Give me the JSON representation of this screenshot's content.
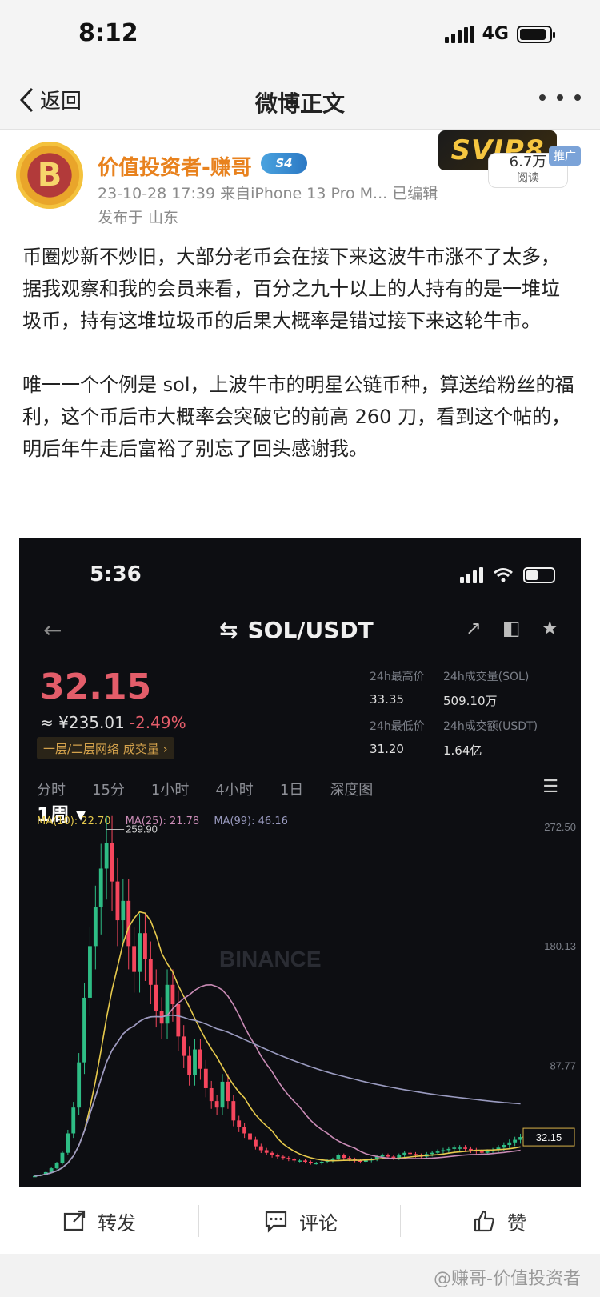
{
  "status_bar": {
    "time": "8:12",
    "network": "4G"
  },
  "nav": {
    "back_label": "返回",
    "title": "微博正文"
  },
  "post": {
    "author": "价值投资者-赚哥",
    "badge": "S4",
    "avatar_glyph": "B",
    "meta_line": "23-10-28 17:39  来自iPhone 13 Pro M...  已编辑",
    "region": "发布于 山东",
    "vip_badge": "SVIP8",
    "promo_tag": "推广",
    "read_count": "6.7万",
    "read_label": "阅读",
    "paragraph_1": "币圈炒新不炒旧，大部分老币会在接下来这波牛市涨不了太多，据我观察和我的会员来看，百分之九十以上的人持有的是一堆垃圾币，持有这堆垃圾币的后果大概率是错过接下来这轮牛市。",
    "paragraph_2": "唯一一个个例是 sol，上波牛市的明星公链币种，算送给粉丝的福利，这个币后市大概率会突破它的前高 260 刀，看到这个帖的，明后年牛走后富裕了别忘了回头感谢我。"
  },
  "screenshot": {
    "time": "5:36",
    "back_glyph": "←",
    "pair": "SOL/USDT",
    "price": "32.15",
    "cny_price": "≈ ¥235.01",
    "change": "-2.49%",
    "tag": "一层/二层网络   成交量 ›",
    "stats": {
      "high_label": "24h最高价",
      "high": "33.35",
      "vol_sol_label": "24h成交量(SOL)",
      "vol_sol": "509.10万",
      "low_label": "24h最低价",
      "low": "31.20",
      "vol_usdt_label": "24h成交额(USDT)",
      "vol_usdt": "1.64亿"
    },
    "timeframes": [
      "分时",
      "15分",
      "1小时",
      "4小时",
      "1日",
      "1周 ▾",
      "深度图"
    ],
    "active_timeframe_index": 5,
    "ma": {
      "ma10": "MA(10): 22.70",
      "ma25": "MA(25): 21.78",
      "ma99": "MA(99): 46.16"
    },
    "watermark": "BINANCE"
  },
  "chart_data": {
    "type": "candlestick",
    "y_ticks": [
      "272.50",
      "180.13",
      "87.77"
    ],
    "peak_label": "259.90",
    "last_price_label": "32.15",
    "ylim": [
      0,
      272.5
    ],
    "close_series": [
      2,
      3,
      5,
      8,
      12,
      20,
      35,
      55,
      90,
      140,
      180,
      210,
      240,
      259.9,
      230,
      200,
      215,
      180,
      160,
      190,
      170,
      150,
      130,
      120,
      150,
      135,
      110,
      95,
      80,
      100,
      85,
      70,
      60,
      55,
      75,
      60,
      45,
      40,
      35,
      30,
      25,
      22,
      20,
      18,
      17,
      16,
      15,
      14,
      14,
      13,
      12,
      12,
      13,
      14,
      15,
      18,
      16,
      15,
      14,
      13,
      14,
      15,
      17,
      18,
      17,
      16,
      18,
      20,
      19,
      18,
      17,
      19,
      20,
      21,
      22,
      23,
      24,
      24,
      23,
      22,
      21,
      20,
      21,
      22,
      24,
      26,
      28,
      30,
      32.15
    ],
    "ma10_color": "#e6c94c",
    "ma25_color": "#c98bb5",
    "ma99_color": "#9a9bc0",
    "up_color": "#2ebd85",
    "down_color": "#f6465d"
  },
  "actions": {
    "repost": "转发",
    "comment": "评论",
    "like": "赞"
  },
  "watermark": "@赚哥-价值投资者"
}
